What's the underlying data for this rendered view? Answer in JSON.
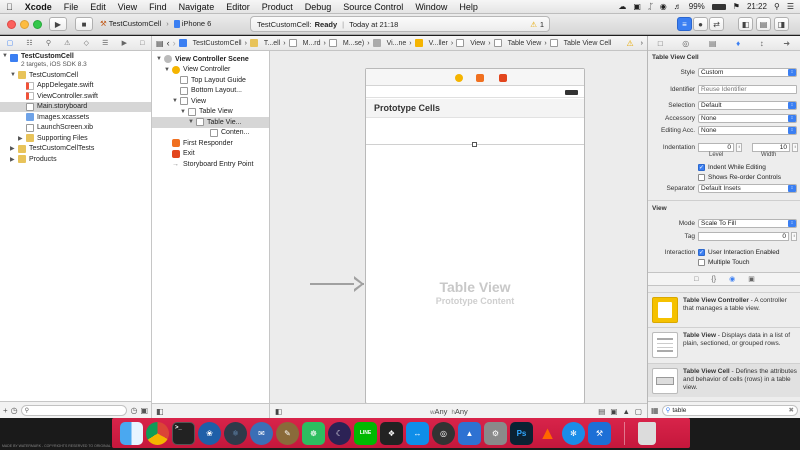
{
  "menubar": {
    "app": "Xcode",
    "items": [
      "File",
      "Edit",
      "View",
      "Find",
      "Navigate",
      "Editor",
      "Product",
      "Debug",
      "Source Control",
      "Window",
      "Help"
    ],
    "battery": "99%",
    "clock": "21:22"
  },
  "toolbar": {
    "scheme": "TestCustomCell",
    "device": "iPhone 6",
    "status_project": "TestCustomCell:",
    "status_state": "Ready",
    "status_time": "Today at 21:18",
    "warning_count": "1"
  },
  "navigator": {
    "items": [
      {
        "label": "TestCustomCell",
        "sub": "2 targets, iOS SDK 8.3",
        "indent": 0,
        "icon": "project",
        "bold": true
      },
      {
        "label": "TestCustomCell",
        "indent": 1,
        "icon": "folder"
      },
      {
        "label": "AppDelegate.swift",
        "indent": 2,
        "icon": "swift"
      },
      {
        "label": "ViewController.swift",
        "indent": 2,
        "icon": "swift"
      },
      {
        "label": "Main.storyboard",
        "indent": 2,
        "icon": "storyboard",
        "selected": true
      },
      {
        "label": "Images.xcassets",
        "indent": 2,
        "icon": "assets"
      },
      {
        "label": "LaunchScreen.xib",
        "indent": 2,
        "icon": "xib"
      },
      {
        "label": "Supporting Files",
        "indent": 2,
        "icon": "folder"
      },
      {
        "label": "TestCustomCellTests",
        "indent": 1,
        "icon": "folder"
      },
      {
        "label": "Products",
        "indent": 1,
        "icon": "folder"
      }
    ]
  },
  "jumpbar": {
    "crumbs": [
      "TestCustomCell",
      "T...ell",
      "M...rd",
      "M...se)",
      "Vi...ne",
      "V...ller",
      "View",
      "Table View",
      "Table View Cell"
    ]
  },
  "outline": {
    "items": [
      {
        "label": "View Controller Scene",
        "indent": 0,
        "bold": true
      },
      {
        "label": "View Controller",
        "indent": 1,
        "icon": "yellow"
      },
      {
        "label": "Top Layout Guide",
        "indent": 2,
        "icon": "box"
      },
      {
        "label": "Bottom Layout...",
        "indent": 2,
        "icon": "box"
      },
      {
        "label": "View",
        "indent": 2,
        "icon": "box"
      },
      {
        "label": "Table View",
        "indent": 3,
        "icon": "box"
      },
      {
        "label": "Table Vie...",
        "indent": 4,
        "icon": "box",
        "selected": true
      },
      {
        "label": "Conten...",
        "indent": 5,
        "icon": "box"
      },
      {
        "label": "First Responder",
        "indent": 1,
        "icon": "orange"
      },
      {
        "label": "Exit",
        "indent": 1,
        "icon": "red"
      },
      {
        "label": "Storyboard Entry Point",
        "indent": 1,
        "icon": "arrow"
      }
    ]
  },
  "canvas": {
    "section_header": "Prototype Cells",
    "table_title": "Table View",
    "table_subtitle": "Prototype Content",
    "size_class_w": "Any",
    "size_class_h": "Any"
  },
  "inspector": {
    "section_cell": "Table View Cell",
    "style_label": "Style",
    "style_value": "Custom",
    "identifier_label": "Identifier",
    "identifier_placeholder": "Reuse Identifier",
    "selection_label": "Selection",
    "selection_value": "Default",
    "accessory_label": "Accessory",
    "accessory_value": "None",
    "editing_label": "Editing Acc.",
    "editing_value": "None",
    "indentation_label": "Indentation",
    "indent_level": "0",
    "indent_width": "10",
    "level_caption": "Level",
    "width_caption": "Width",
    "indent_while_editing": "Indent While Editing",
    "shows_reorder": "Shows Re-order Controls",
    "separator_label": "Separator",
    "separator_value": "Default Insets",
    "section_view": "View",
    "mode_label": "Mode",
    "mode_value": "Scale To Fill",
    "tag_label": "Tag",
    "tag_value": "0",
    "interaction_label": "Interaction",
    "user_interaction": "User Interaction Enabled",
    "multiple_touch": "Multiple Touch",
    "library": [
      {
        "title": "Table View Controller",
        "desc": " - A controller that manages a table view."
      },
      {
        "title": "Table View",
        "desc": " - Displays data in a list of plain, sectioned, or grouped rows."
      },
      {
        "title": "Table View Cell",
        "desc": " - Defines the attributes and behavior of cells (rows) in a table view."
      }
    ],
    "search_value": "table"
  },
  "dock": {
    "watermark": "MADE BY WATERMARK - COPYRIGHTS RESERVED TO ORIGINAL"
  },
  "colors": {
    "accent": "#3b7ff2",
    "dock": "#d0203f",
    "warning": "#f5b400"
  }
}
